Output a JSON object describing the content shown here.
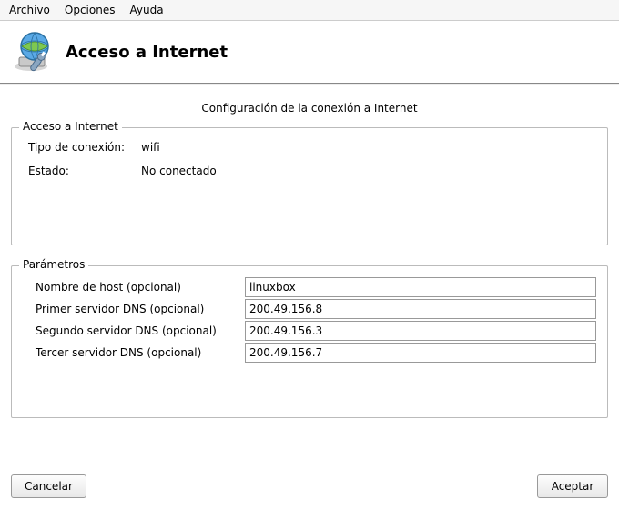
{
  "menu": {
    "file": "Archivo",
    "options": "Opciones",
    "help": "Ayuda"
  },
  "header": {
    "title": "Acceso a Internet"
  },
  "subtitle": "Configuración de la conexión a Internet",
  "access": {
    "legend": "Acceso a Internet",
    "type_label": "Tipo de conexión:",
    "type_value": "wifi",
    "status_label": "Estado:",
    "status_value": "No conectado"
  },
  "params": {
    "legend": "Parámetros",
    "hostname_label": "Nombre de host (opcional)",
    "hostname_value": "linuxbox",
    "dns1_label": "Primer servidor DNS (opcional)",
    "dns1_value": "200.49.156.8",
    "dns2_label": "Segundo servidor DNS (opcional)",
    "dns2_value": "200.49.156.3",
    "dns3_label": "Tercer servidor DNS (opcional)",
    "dns3_value": "200.49.156.7"
  },
  "buttons": {
    "cancel": "Cancelar",
    "accept": "Aceptar"
  }
}
